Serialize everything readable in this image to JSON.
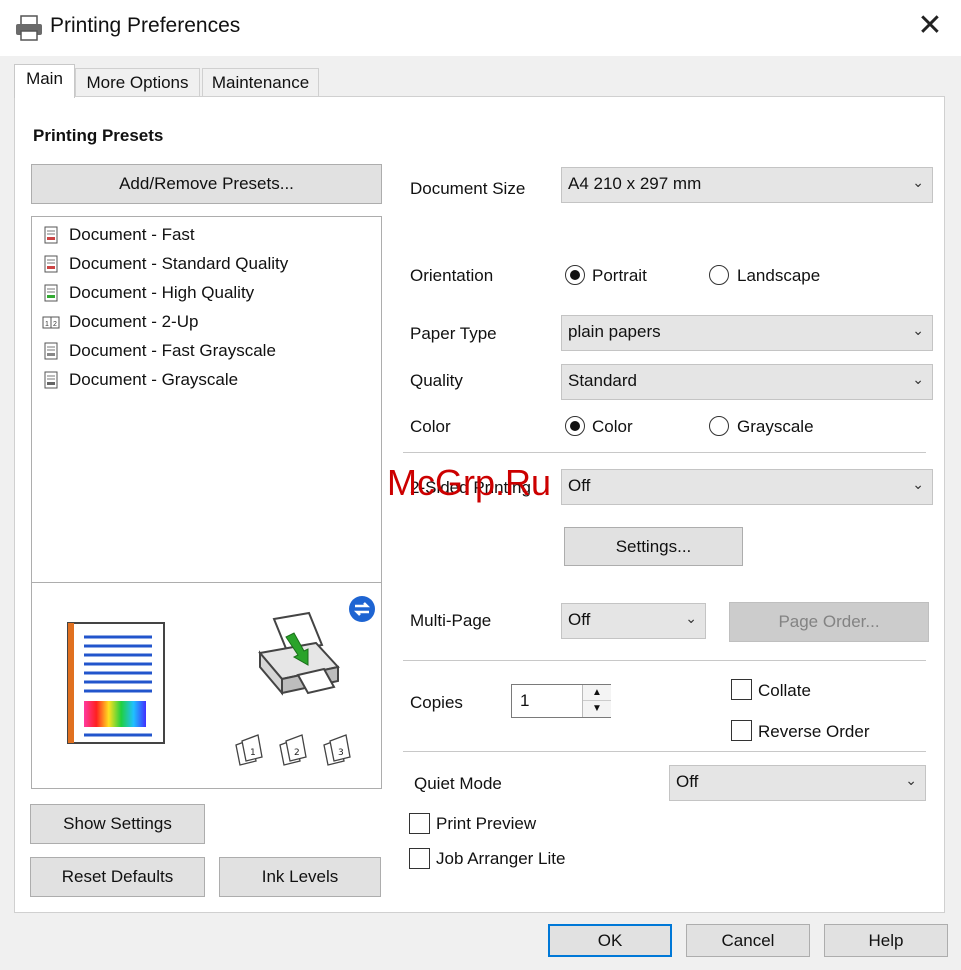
{
  "window": {
    "title": "Printing Preferences"
  },
  "tabs": [
    {
      "label": "Main",
      "active": true
    },
    {
      "label": "More Options",
      "active": false
    },
    {
      "label": "Maintenance",
      "active": false
    }
  ],
  "presets": {
    "heading": "Printing Presets",
    "add_remove_button": "Add/Remove Presets...",
    "items": [
      {
        "label": "Document - Fast",
        "icon": "document-fast-icon"
      },
      {
        "label": "Document - Standard Quality",
        "icon": "document-standard-icon"
      },
      {
        "label": "Document - High Quality",
        "icon": "document-high-quality-icon"
      },
      {
        "label": "Document - 2-Up",
        "icon": "document-2up-icon"
      },
      {
        "label": "Document - Fast Grayscale",
        "icon": "document-fast-grayscale-icon"
      },
      {
        "label": "Document - Grayscale",
        "icon": "document-grayscale-icon"
      }
    ]
  },
  "left_buttons": {
    "show_settings": "Show Settings",
    "reset_defaults": "Reset Defaults",
    "ink_levels": "Ink Levels"
  },
  "settings": {
    "document_size": {
      "label": "Document Size",
      "value": "A4 210 x 297 mm"
    },
    "orientation": {
      "label": "Orientation",
      "options": [
        "Portrait",
        "Landscape"
      ],
      "selected": "Portrait"
    },
    "paper_type": {
      "label": "Paper Type",
      "value": "plain papers"
    },
    "quality": {
      "label": "Quality",
      "value": "Standard"
    },
    "color": {
      "label": "Color",
      "options": [
        "Color",
        "Grayscale"
      ],
      "selected": "Color"
    },
    "two_sided": {
      "label": "2-Sided Printing",
      "value": "Off"
    },
    "settings_button": "Settings...",
    "multi_page": {
      "label": "Multi-Page",
      "value": "Off",
      "page_order_button": "Page Order..."
    },
    "copies": {
      "label": "Copies",
      "value": "1"
    },
    "collate": {
      "label": "Collate",
      "checked": false
    },
    "reverse_order": {
      "label": "Reverse Order",
      "checked": false
    },
    "quiet_mode": {
      "label": "Quiet Mode",
      "value": "Off"
    },
    "print_preview": {
      "label": "Print Preview",
      "checked": false
    },
    "job_arranger": {
      "label": "Job Arranger Lite",
      "checked": false
    }
  },
  "footer": {
    "ok": "OK",
    "cancel": "Cancel",
    "help": "Help"
  },
  "watermark": "McGrp.Ru",
  "colors": {
    "accent": "#0078d7",
    "watermark": "#cc0000",
    "print_arrow": "#2aa32a"
  }
}
